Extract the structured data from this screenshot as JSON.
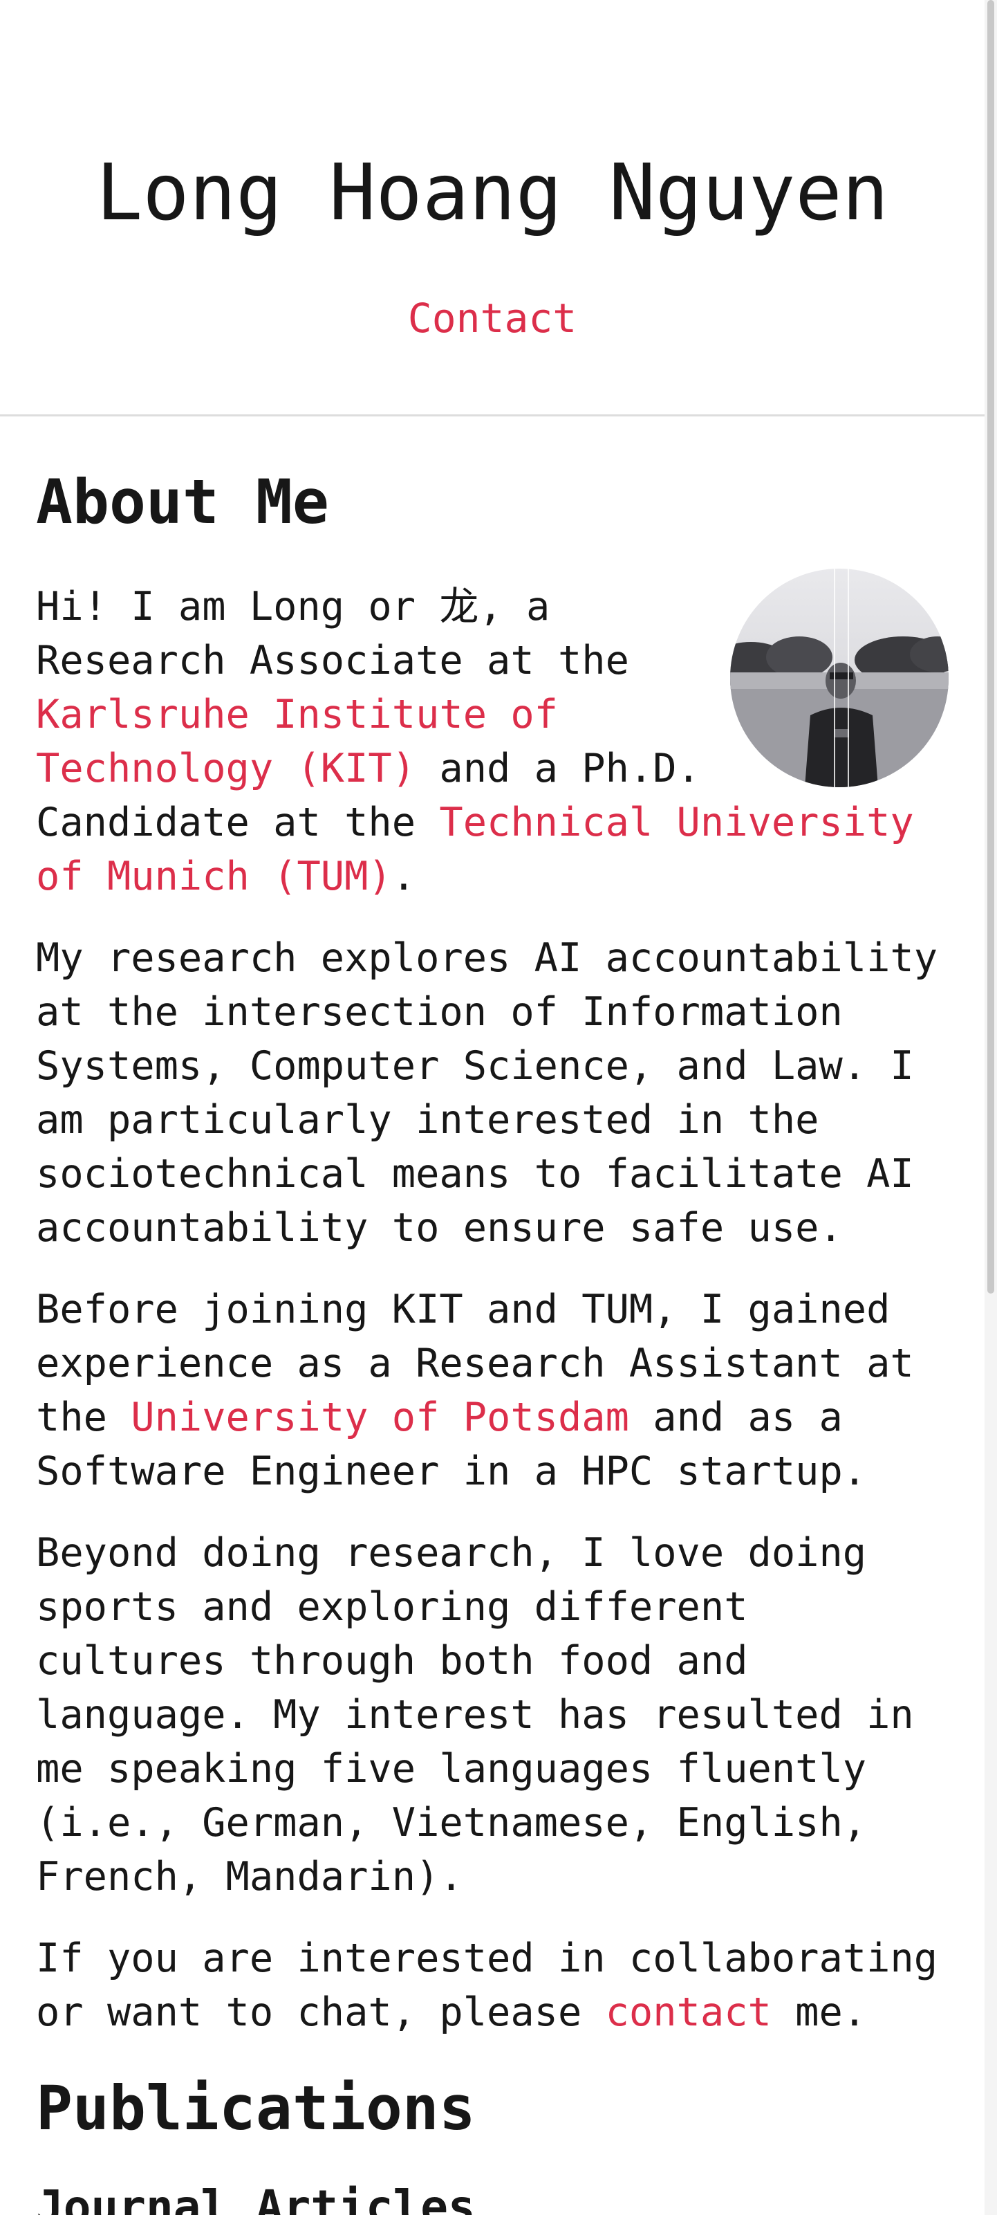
{
  "header": {
    "title": "Long Hoang Nguyen",
    "contact_label": "Contact"
  },
  "about": {
    "heading": "About Me",
    "avatar_icon": "profile-photo",
    "p1": {
      "t1": "Hi! I am Long or 龙, a Research Associate at the ",
      "link1": "Karlsruhe Institute of Technology (KIT)",
      "t2": " and a Ph.D. Candidate at the ",
      "link2": "Technical University of Munich (TUM)",
      "t3": "."
    },
    "p2": "My research explores AI accountability at the intersection of Information Systems, Computer Science, and Law. I am particularly interested in the sociotechnical means to facilitate AI accountability to ensure safe use.",
    "p3": {
      "t1": "Before joining KIT and TUM, I gained experience as a Research Assistant at the ",
      "link1": "University of Potsdam",
      "t2": " and as a Software Engineer in a HPC startup."
    },
    "p4": "Beyond doing research, I love doing sports and exploring different cultures through both food and language. My interest has resulted in me speaking five languages fluently (i.e., German, Vietnamese, English, French, Mandarin).",
    "p5": {
      "t1": "If you are interested in collaborating or want to chat, please ",
      "link1": "contact",
      "t2": " me."
    }
  },
  "publications": {
    "heading": "Publications",
    "subheading": "Journal Articles"
  },
  "colors": {
    "accent": "#dc2e4a",
    "text": "#171717"
  }
}
